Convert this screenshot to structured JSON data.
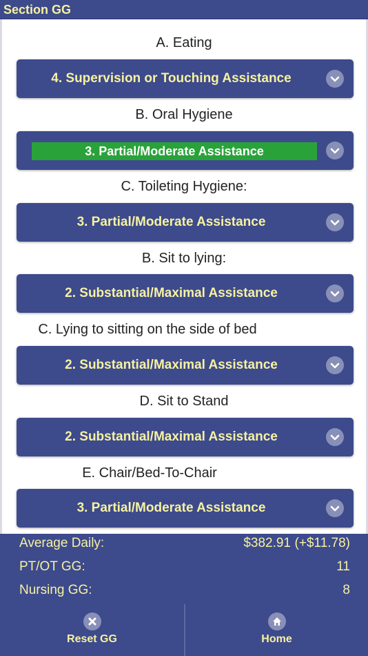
{
  "header": {
    "title": "Section GG"
  },
  "questions": [
    {
      "label": "A. Eating",
      "selected": "4. Supervision or Touching Assistance"
    },
    {
      "label": "B. Oral Hygiene",
      "selected": "3. Partial/Moderate Assistance"
    },
    {
      "label": "C. Toileting Hygiene:",
      "selected": "3. Partial/Moderate Assistance"
    },
    {
      "label": "B. Sit to lying:",
      "selected": "2. Substantial/Maximal Assistance"
    },
    {
      "label": "C. Lying to sitting on the side of bed",
      "selected": "2. Substantial/Maximal Assistance"
    },
    {
      "label": "D. Sit to Stand",
      "selected": "2. Substantial/Maximal Assistance"
    },
    {
      "label": "E. Chair/Bed-To-Chair",
      "selected": "3. Partial/Moderate Assistance"
    }
  ],
  "summary": {
    "average_daily_label": "Average Daily:",
    "average_daily_value": "$382.91",
    "average_daily_delta": "(+$11.78)",
    "ptot_label": "PT/OT GG:",
    "ptot_value": "11",
    "nursing_label": "Nursing GG:",
    "nursing_value": "8"
  },
  "bottom_nav": {
    "reset_label": "Reset GG",
    "home_label": "Home"
  },
  "colors": {
    "bar": "#3d4a8c",
    "accent_text": "#f6f2a0",
    "highlight": "#2aa23a"
  },
  "icons": [
    "chevron-down-icon",
    "close-icon",
    "home-icon"
  ]
}
